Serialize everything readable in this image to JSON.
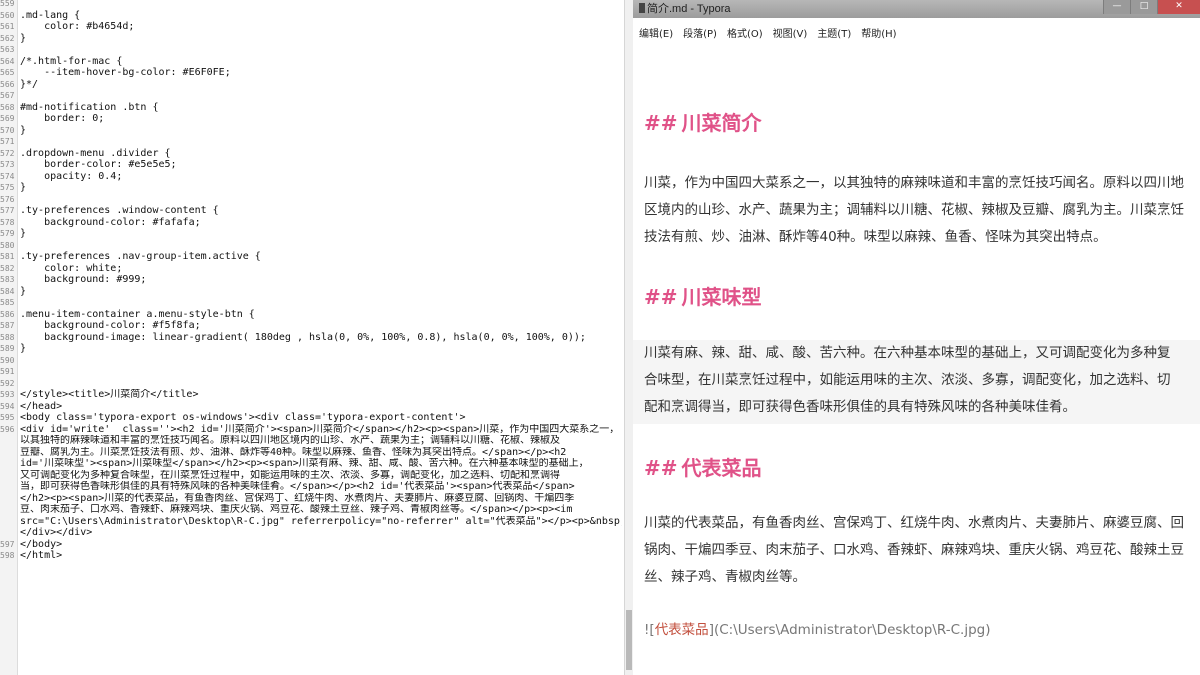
{
  "editor": {
    "lines": [
      {
        "n": "559",
        "t": ""
      },
      {
        "n": "560",
        "t": ".md-lang {"
      },
      {
        "n": "561",
        "t": "    color: #b4654d;"
      },
      {
        "n": "562",
        "t": "}"
      },
      {
        "n": "563",
        "t": ""
      },
      {
        "n": "564",
        "t": "/*.html-for-mac {"
      },
      {
        "n": "565",
        "t": "    --item-hover-bg-color: #E6F0FE;"
      },
      {
        "n": "566",
        "t": "}*/"
      },
      {
        "n": "567",
        "t": ""
      },
      {
        "n": "568",
        "t": "#md-notification .btn {"
      },
      {
        "n": "569",
        "t": "    border: 0;"
      },
      {
        "n": "570",
        "t": "}"
      },
      {
        "n": "571",
        "t": ""
      },
      {
        "n": "572",
        "t": ".dropdown-menu .divider {"
      },
      {
        "n": "573",
        "t": "    border-color: #e5e5e5;"
      },
      {
        "n": "574",
        "t": "    opacity: 0.4;"
      },
      {
        "n": "575",
        "t": "}"
      },
      {
        "n": "576",
        "t": ""
      },
      {
        "n": "577",
        "t": ".ty-preferences .window-content {"
      },
      {
        "n": "578",
        "t": "    background-color: #fafafa;"
      },
      {
        "n": "579",
        "t": "}"
      },
      {
        "n": "580",
        "t": ""
      },
      {
        "n": "581",
        "t": ".ty-preferences .nav-group-item.active {"
      },
      {
        "n": "582",
        "t": "    color: white;"
      },
      {
        "n": "583",
        "t": "    background: #999;"
      },
      {
        "n": "584",
        "t": "}"
      },
      {
        "n": "585",
        "t": ""
      },
      {
        "n": "586",
        "t": ".menu-item-container a.menu-style-btn {"
      },
      {
        "n": "587",
        "t": "    background-color: #f5f8fa;"
      },
      {
        "n": "588",
        "t": "    background-image: linear-gradient( 180deg , hsla(0, 0%, 100%, 0.8), hsla(0, 0%, 100%, 0));"
      },
      {
        "n": "589",
        "t": "}"
      },
      {
        "n": "590",
        "t": ""
      },
      {
        "n": "591",
        "t": ""
      },
      {
        "n": "592",
        "t": ""
      },
      {
        "n": "593",
        "t": "</style><title>川菜简介</title>"
      },
      {
        "n": "594",
        "t": "</head>"
      },
      {
        "n": "595",
        "t": "<body class='typora-export os-windows'><div class='typora-export-content'>"
      },
      {
        "n": "596",
        "t": "<div id='write'  class=''><h2 id='川菜简介'><span>川菜简介</span></h2><p><span>川菜，作为中国四大菜系之一，"
      },
      {
        "n": "",
        "t": "以其独特的麻辣味道和丰富的烹饪技巧闻名。原料以四川地区境内的山珍、水产、蔬果为主；调辅料以川糖、花椒、辣椒及"
      },
      {
        "n": "",
        "t": "豆瓣、腐乳为主。川菜烹饪技法有煎、炒、油淋、酥炸等40种。味型以麻辣、鱼香、怪味为其突出特点。</span></p><h2"
      },
      {
        "n": "",
        "t": "id='川菜味型'><span>川菜味型</span></h2><p><span>川菜有麻、辣、甜、咸、酸、苦六种。在六种基本味型的基础上，"
      },
      {
        "n": "",
        "t": "又可调配变化为多种复合味型，在川菜烹饪过程中，如能运用味的主次、浓淡、多寡，调配变化，加之选料、切配和烹调得"
      },
      {
        "n": "",
        "t": "当，即可获得色香味形俱佳的具有特殊风味的各种美味佳肴。</span></p><h2 id='代表菜品'><span>代表菜品</span>"
      },
      {
        "n": "",
        "t": "</h2><p><span>川菜的代表菜品，有鱼香肉丝、宫保鸡丁、红烧牛肉、水煮肉片、夫妻肺片、麻婆豆腐、回锅肉、干煸四季"
      },
      {
        "n": "",
        "t": "豆、肉末茄子、口水鸡、香辣虾、麻辣鸡块、重庆火锅、鸡豆花、酸辣土豆丝、辣子鸡、青椒肉丝等。</span></p><p><im"
      },
      {
        "n": "",
        "t": "src=\"C:\\Users\\Administrator\\Desktop\\R-C.jpg\" referrerpolicy=\"no-referrer\" alt=\"代表菜品\"></p><p>&nbsp;</p>"
      },
      {
        "n": "",
        "t": "</div></div>"
      },
      {
        "n": "597",
        "t": "</body>"
      },
      {
        "n": "598",
        "t": "</html>"
      }
    ]
  },
  "typora": {
    "title": "简介.md - Typora",
    "window_buttons": [
      "—",
      "□",
      "✕"
    ],
    "menu": [
      "编辑(E)",
      "段落(P)",
      "格式(O)",
      "视图(V)",
      "主题(T)",
      "帮助(H)"
    ],
    "doc": {
      "hash": "##",
      "sections": [
        {
          "heading": "川菜简介",
          "body": "川菜，作为中国四大菜系之一，以其独特的麻辣味道和丰富的烹饪技巧闻名。原料以四川地区境内的山珍、水产、蔬果为主；调辅料以川糖、花椒、辣椒及豆瓣、腐乳为主。川菜烹饪技法有煎、炒、油淋、酥炸等40种。味型以麻辣、鱼香、怪味为其突出特点。"
        },
        {
          "heading": "川菜味型",
          "body": "川菜有麻、辣、甜、咸、酸、苦六种。在六种基本味型的基础上，又可调配变化为多种复合味型，在川菜烹饪过程中，如能运用味的主次、浓淡、多寡，调配变化，加之选料、切配和烹调得当，即可获得色香味形俱佳的具有特殊风味的各种美味佳肴。"
        },
        {
          "heading": "代表菜品",
          "body": "川菜的代表菜品，有鱼香肉丝、宫保鸡丁、红烧牛肉、水煮肉片、夫妻肺片、麻婆豆腐、回锅肉、干煸四季豆、肉末茄子、口水鸡、香辣虾、麻辣鸡块、重庆火锅、鸡豆花、酸辣土豆丝、辣子鸡、青椒肉丝等。"
        }
      ],
      "image": {
        "open": "![",
        "alt": "代表菜品",
        "mid": "](",
        "path": "C:\\Users\\Administrator\\Desktop\\R-C.jpg",
        "close": ")"
      }
    }
  },
  "colors": {
    "heading": "#e05288",
    "body_text": "#333333",
    "link_alt": "#c24f3d"
  }
}
